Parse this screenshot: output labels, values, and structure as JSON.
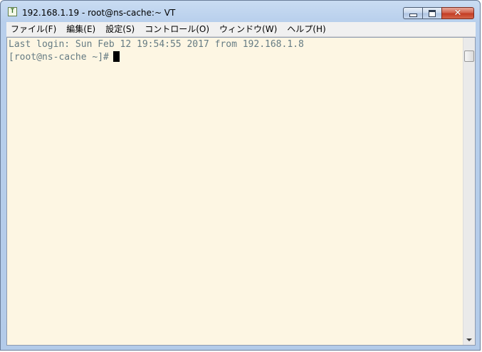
{
  "window": {
    "title": "192.168.1.19 - root@ns-cache:~ VT",
    "icon": "terminal-app-icon",
    "icon_glyph": "T",
    "controls": {
      "minimize": "minimize-icon",
      "maximize": "maximize-icon",
      "close": "close-icon",
      "close_glyph": "✕"
    }
  },
  "menu": {
    "items": [
      {
        "label": "ファイル(F)"
      },
      {
        "label": "編集(E)"
      },
      {
        "label": "設定(S)"
      },
      {
        "label": "コントロール(O)"
      },
      {
        "label": "ウィンドウ(W)"
      },
      {
        "label": "ヘルプ(H)"
      }
    ]
  },
  "terminal": {
    "lines": [
      "Last login: Sun Feb 12 19:54:55 2017 from 192.168.1.8",
      "[root@ns-cache ~]#"
    ],
    "background": "#fdf6e3",
    "foreground": "#657b83",
    "cursor_color": "#000000"
  },
  "colors": {
    "titlebar": "#c9dcf2",
    "close_button": "#c43d24"
  }
}
